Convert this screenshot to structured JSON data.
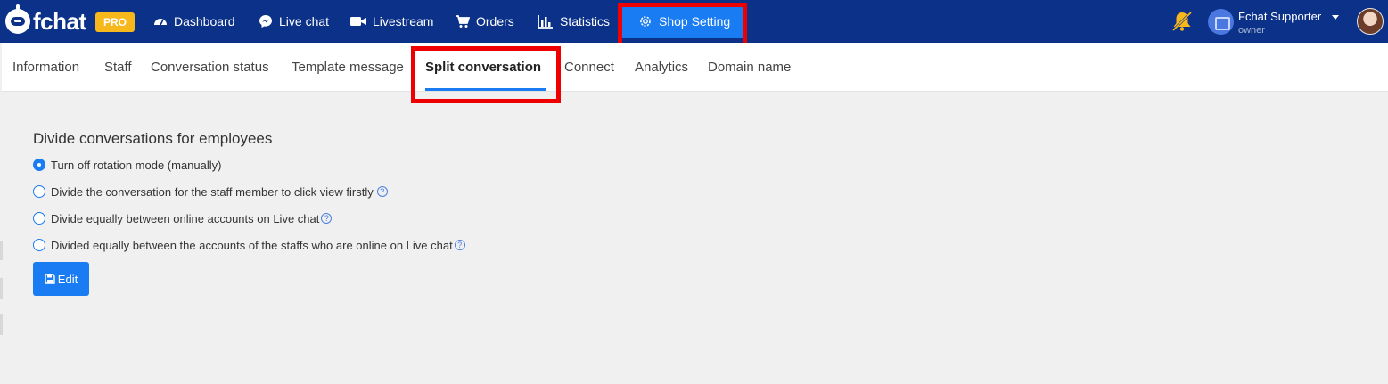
{
  "app": {
    "logo_text": "fchat",
    "badge": "PRO"
  },
  "nav": {
    "dashboard": "Dashboard",
    "live_chat": "Live chat",
    "livestream": "Livestream",
    "orders": "Orders",
    "statistics": "Statistics",
    "shop_setting": "Shop Setting"
  },
  "user": {
    "name": "Fchat Supporter",
    "role": "owner"
  },
  "tabs": {
    "information": "Information",
    "staff": "Staff",
    "conversation_status": "Conversation status",
    "template_message": "Template message",
    "split_conversation": "Split conversation",
    "connect": "Connect",
    "analytics": "Analytics",
    "domain_name": "Domain name"
  },
  "main": {
    "title": "Divide conversations for employees",
    "options": [
      {
        "label": "Turn off rotation mode (manually)",
        "selected": true,
        "help": false
      },
      {
        "label": "Divide the conversation for the staff member to click view firstly",
        "selected": false,
        "help": true
      },
      {
        "label": "Divide equally between online accounts on Live chat",
        "selected": false,
        "help": true
      },
      {
        "label": "Divided equally between the accounts of the staffs who are online on Live chat",
        "selected": false,
        "help": true
      }
    ],
    "help_glyph": "?",
    "edit_label": "Edit"
  },
  "icons": {
    "dashboard": "dashboard-icon",
    "live_chat": "messenger-icon",
    "livestream": "video-camera-icon",
    "orders": "cart-icon",
    "statistics": "bar-chart-icon",
    "shop_setting": "gear-icon",
    "bell": "bell-slash-icon",
    "edit": "save-icon"
  },
  "colors": {
    "navbar": "#0b3189",
    "accent": "#1a7cf3",
    "highlight": "#ee0000",
    "badge": "#f6b81b"
  }
}
